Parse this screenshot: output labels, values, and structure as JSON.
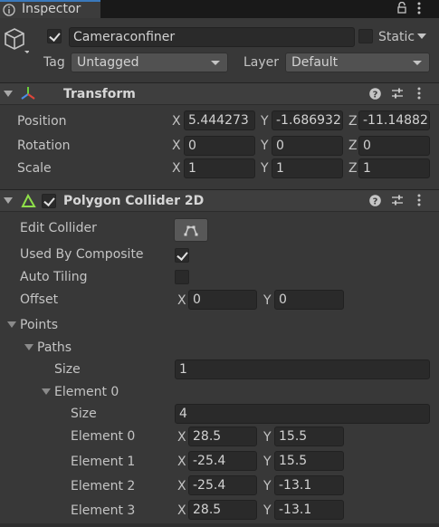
{
  "tab": {
    "label": "Inspector",
    "icon": "info-icon"
  },
  "object": {
    "name": "Cameraconfiner",
    "active": true,
    "static_label": "Static",
    "static": false,
    "tag_label": "Tag",
    "tag_value": "Untagged",
    "layer_label": "Layer",
    "layer_value": "Default"
  },
  "transform": {
    "title": "Transform",
    "position_label": "Position",
    "rotation_label": "Rotation",
    "scale_label": "Scale",
    "x": "X",
    "y": "Y",
    "z": "Z",
    "position": {
      "x": "5.444273",
      "y": "-1.686932",
      "z": "-11.14882"
    },
    "rotation": {
      "x": "0",
      "y": "0",
      "z": "0"
    },
    "scale": {
      "x": "1",
      "y": "1",
      "z": "1"
    }
  },
  "collider": {
    "title": "Polygon Collider 2D",
    "enabled": true,
    "edit_collider_label": "Edit Collider",
    "used_by_composite_label": "Used By Composite",
    "used_by_composite": true,
    "auto_tiling_label": "Auto Tiling",
    "auto_tiling": false,
    "offset_label": "Offset",
    "offset": {
      "x": "0",
      "y": "0"
    },
    "points_label": "Points",
    "paths_label": "Paths",
    "size_label": "Size",
    "paths_size": "1",
    "element0_label": "Element 0",
    "element_size": "4",
    "elements": [
      {
        "label": "Element 0",
        "x": "28.5",
        "y": "15.5"
      },
      {
        "label": "Element 1",
        "x": "-25.4",
        "y": "15.5"
      },
      {
        "label": "Element 2",
        "x": "-25.4",
        "y": "-13.1"
      },
      {
        "label": "Element 3",
        "x": "28.5",
        "y": "-13.1"
      }
    ]
  }
}
